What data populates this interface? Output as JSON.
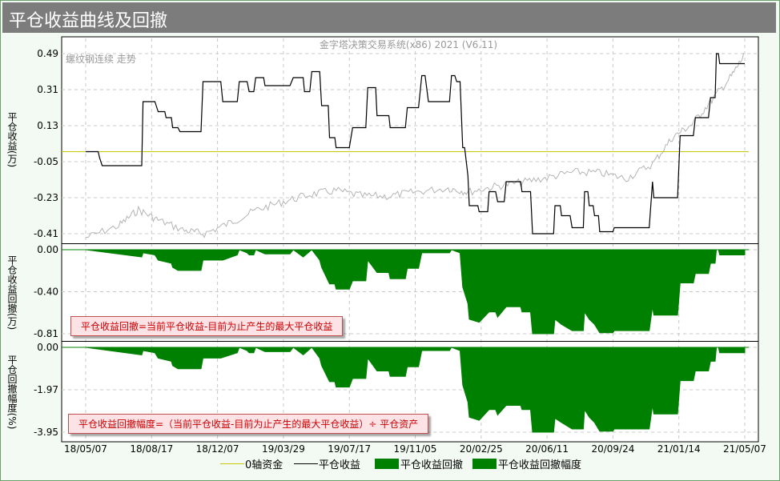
{
  "title": "平仓收益曲线及回撤",
  "watermark": "金字塔决策交易系统(x86) 2021 (V6.11)",
  "price_label": "螺纹钢连续 走势",
  "notes": {
    "drawdown": "平仓收益回撤=当前平仓收益-目前为止产生的最大平仓收益",
    "drawdown_pct": "平仓收益回撤幅度=（当前平仓收益-目前为止产生的最大平仓收益）÷ 平仓资产"
  },
  "colors": {
    "zero_line": "#c8c800",
    "equity": "#000000",
    "drawdown": "#008000",
    "price": "#b4b4b4",
    "grid": "#c8c8c8"
  },
  "legend": [
    {
      "label": "0轴资金",
      "kind": "line",
      "color": "#c8c800"
    },
    {
      "label": "平仓收益",
      "kind": "line",
      "color": "#000000"
    },
    {
      "label": "平仓收益回撤",
      "kind": "box",
      "color": "#008000"
    },
    {
      "label": "平仓收益回撤幅度",
      "kind": "box",
      "color": "#008000"
    }
  ],
  "chart_data": [
    {
      "type": "line",
      "ylabel": "平仓收益(万)",
      "yticks": [
        "0.49",
        "0.31",
        "0.13",
        "-0.05",
        "-0.23",
        "-0.41"
      ],
      "ylim": [
        -0.41,
        0.49
      ],
      "x": [
        "18/05/07",
        "18/08/17",
        "18/12/07",
        "19/03/29",
        "19/07/17",
        "19/11/05",
        "20/02/25",
        "20/06/11",
        "20/09/24",
        "21/01/14",
        "21/05/07"
      ],
      "zero_line": 0.0,
      "series": [
        {
          "name": "平仓收益",
          "points": [
            [
              0,
              0
            ],
            [
              0.19,
              0
            ],
            [
              0.21,
              -0.03
            ],
            [
              0.25,
              -0.07
            ],
            [
              0.85,
              -0.07
            ],
            [
              0.87,
              0.25
            ],
            [
              1.05,
              0.25
            ],
            [
              1.1,
              0.2
            ],
            [
              1.2,
              0.2
            ],
            [
              1.22,
              0.17
            ],
            [
              1.3,
              0.17
            ],
            [
              1.32,
              0.12
            ],
            [
              1.4,
              0.12
            ],
            [
              1.43,
              0.1
            ],
            [
              1.75,
              0.1
            ],
            [
              1.78,
              0.35
            ],
            [
              2.05,
              0.35
            ],
            [
              2.08,
              0.25
            ],
            [
              2.3,
              0.25
            ],
            [
              2.33,
              0.35
            ],
            [
              2.45,
              0.35
            ],
            [
              2.48,
              0.3
            ],
            [
              2.55,
              0.3
            ],
            [
              2.58,
              0.37
            ],
            [
              2.7,
              0.37
            ],
            [
              2.72,
              0.33
            ],
            [
              3.1,
              0.33
            ],
            [
              3.15,
              0.37
            ],
            [
              3.3,
              0.37
            ],
            [
              3.32,
              0.3
            ],
            [
              3.4,
              0.3
            ],
            [
              3.43,
              0.4
            ],
            [
              3.55,
              0.4
            ],
            [
              3.58,
              0.23
            ],
            [
              3.68,
              0.23
            ],
            [
              3.7,
              0.07
            ],
            [
              3.78,
              0.07
            ],
            [
              3.8,
              0.02
            ],
            [
              4.0,
              0.02
            ],
            [
              4.05,
              0.12
            ],
            [
              4.25,
              0.12
            ],
            [
              4.28,
              0.32
            ],
            [
              4.4,
              0.32
            ],
            [
              4.42,
              0.18
            ],
            [
              4.6,
              0.18
            ],
            [
              4.62,
              0.12
            ],
            [
              4.85,
              0.12
            ],
            [
              4.88,
              0.22
            ],
            [
              5.05,
              0.22
            ],
            [
              5.1,
              0.38
            ],
            [
              5.15,
              0.38
            ],
            [
              5.2,
              0.25
            ],
            [
              5.52,
              0.25
            ],
            [
              5.55,
              0.38
            ],
            [
              5.6,
              0.38
            ],
            [
              5.63,
              0.35
            ],
            [
              5.68,
              0.35
            ],
            [
              5.72,
              0.02
            ],
            [
              5.75,
              0.02
            ],
            [
              5.8,
              -0.12
            ],
            [
              5.82,
              -0.27
            ],
            [
              5.95,
              -0.27
            ],
            [
              5.97,
              -0.3
            ],
            [
              6.1,
              -0.3
            ],
            [
              6.12,
              -0.2
            ],
            [
              6.22,
              -0.2
            ],
            [
              6.25,
              -0.25
            ],
            [
              6.35,
              -0.25
            ],
            [
              6.38,
              -0.15
            ],
            [
              6.6,
              -0.15
            ],
            [
              6.62,
              -0.2
            ],
            [
              6.75,
              -0.2
            ],
            [
              6.78,
              -0.41
            ],
            [
              7.1,
              -0.41
            ],
            [
              7.12,
              -0.27
            ],
            [
              7.2,
              -0.27
            ],
            [
              7.22,
              -0.32
            ],
            [
              7.35,
              -0.32
            ],
            [
              7.38,
              -0.38
            ],
            [
              7.55,
              -0.38
            ],
            [
              7.57,
              -0.2
            ],
            [
              7.62,
              -0.2
            ],
            [
              7.64,
              -0.27
            ],
            [
              7.7,
              -0.27
            ],
            [
              7.72,
              -0.32
            ],
            [
              7.78,
              -0.32
            ],
            [
              7.8,
              -0.4
            ],
            [
              8.0,
              -0.4
            ],
            [
              8.02,
              -0.38
            ],
            [
              8.55,
              -0.38
            ],
            [
              8.6,
              -0.15
            ],
            [
              8.62,
              -0.23
            ],
            [
              8.98,
              -0.23
            ],
            [
              9.02,
              0.08
            ],
            [
              9.22,
              0.08
            ],
            [
              9.25,
              0.17
            ],
            [
              9.45,
              0.17
            ],
            [
              9.48,
              0.27
            ],
            [
              9.55,
              0.27
            ],
            [
              9.57,
              0.49
            ],
            [
              9.6,
              0.49
            ],
            [
              9.62,
              0.44
            ],
            [
              10.0,
              0.44
            ]
          ]
        }
      ]
    },
    {
      "type": "area",
      "ylabel": "平仓收益回撤(万)",
      "yticks": [
        "0.00",
        "-0.40",
        "-0.81"
      ],
      "ylim": [
        -0.81,
        0.0
      ],
      "series": [
        {
          "name": "平仓收益回撤",
          "points": [
            [
              0,
              0
            ],
            [
              0.85,
              -0.07
            ],
            [
              0.87,
              -0.03
            ],
            [
              1.05,
              -0.05
            ],
            [
              1.1,
              -0.1
            ],
            [
              1.3,
              -0.13
            ],
            [
              1.32,
              -0.17
            ],
            [
              1.4,
              -0.2
            ],
            [
              1.43,
              -0.2
            ],
            [
              1.75,
              -0.2
            ],
            [
              1.78,
              -0.1
            ],
            [
              2.05,
              -0.1
            ],
            [
              2.08,
              -0.1
            ],
            [
              2.3,
              -0.05
            ],
            [
              2.33,
              0
            ],
            [
              2.45,
              -0.03
            ],
            [
              2.48,
              -0.05
            ],
            [
              2.55,
              -0.05
            ],
            [
              2.58,
              0
            ],
            [
              2.72,
              -0.04
            ],
            [
              3.1,
              -0.04
            ],
            [
              3.15,
              0
            ],
            [
              3.3,
              -0.07
            ],
            [
              3.43,
              0
            ],
            [
              3.55,
              -0.1
            ],
            [
              3.58,
              -0.17
            ],
            [
              3.7,
              -0.33
            ],
            [
              3.78,
              -0.33
            ],
            [
              3.8,
              -0.38
            ],
            [
              4.0,
              -0.38
            ],
            [
              4.05,
              -0.3
            ],
            [
              4.25,
              -0.3
            ],
            [
              4.28,
              -0.1
            ],
            [
              4.42,
              -0.22
            ],
            [
              4.6,
              -0.22
            ],
            [
              4.62,
              -0.28
            ],
            [
              4.85,
              -0.28
            ],
            [
              4.88,
              -0.18
            ],
            [
              5.05,
              -0.18
            ],
            [
              5.1,
              -0.03
            ],
            [
              5.2,
              -0.03
            ],
            [
              5.52,
              -0.03
            ],
            [
              5.55,
              0
            ],
            [
              5.68,
              -0.03
            ],
            [
              5.72,
              -0.36
            ],
            [
              5.8,
              -0.52
            ],
            [
              5.82,
              -0.67
            ],
            [
              5.97,
              -0.7
            ],
            [
              6.12,
              -0.6
            ],
            [
              6.22,
              -0.6
            ],
            [
              6.25,
              -0.65
            ],
            [
              6.38,
              -0.55
            ],
            [
              6.6,
              -0.55
            ],
            [
              6.62,
              -0.6
            ],
            [
              6.75,
              -0.6
            ],
            [
              6.78,
              -0.81
            ],
            [
              7.1,
              -0.81
            ],
            [
              7.12,
              -0.67
            ],
            [
              7.22,
              -0.72
            ],
            [
              7.38,
              -0.78
            ],
            [
              7.55,
              -0.78
            ],
            [
              7.57,
              -0.6
            ],
            [
              7.64,
              -0.67
            ],
            [
              7.72,
              -0.72
            ],
            [
              7.8,
              -0.8
            ],
            [
              8.0,
              -0.8
            ],
            [
              8.02,
              -0.78
            ],
            [
              8.55,
              -0.78
            ],
            [
              8.6,
              -0.55
            ],
            [
              8.62,
              -0.63
            ],
            [
              8.98,
              -0.63
            ],
            [
              9.02,
              -0.32
            ],
            [
              9.22,
              -0.32
            ],
            [
              9.25,
              -0.23
            ],
            [
              9.45,
              -0.23
            ],
            [
              9.48,
              -0.13
            ],
            [
              9.55,
              -0.13
            ],
            [
              9.57,
              0
            ],
            [
              9.6,
              0
            ],
            [
              9.62,
              -0.05
            ],
            [
              10.0,
              -0.05
            ]
          ]
        }
      ]
    },
    {
      "type": "area",
      "ylabel": "平仓回撤幅度(%)",
      "yticks": [
        "0.00",
        "-1.97",
        "-3.95"
      ],
      "ylim": [
        -3.95,
        0.0
      ],
      "series": [
        {
          "name": "平仓收益回撤幅度",
          "points": [
            [
              0,
              0
            ],
            [
              0.85,
              -0.35
            ],
            [
              0.87,
              -0.15
            ],
            [
              1.05,
              -0.25
            ],
            [
              1.1,
              -0.5
            ],
            [
              1.3,
              -0.65
            ],
            [
              1.32,
              -0.85
            ],
            [
              1.4,
              -1.0
            ],
            [
              1.75,
              -1.0
            ],
            [
              1.78,
              -0.5
            ],
            [
              2.05,
              -0.5
            ],
            [
              2.3,
              -0.25
            ],
            [
              2.33,
              0
            ],
            [
              2.45,
              -0.15
            ],
            [
              2.48,
              -0.25
            ],
            [
              2.55,
              -0.25
            ],
            [
              2.58,
              0
            ],
            [
              2.72,
              -0.2
            ],
            [
              3.1,
              -0.2
            ],
            [
              3.15,
              0
            ],
            [
              3.3,
              -0.35
            ],
            [
              3.43,
              0
            ],
            [
              3.55,
              -0.5
            ],
            [
              3.58,
              -0.85
            ],
            [
              3.7,
              -1.6
            ],
            [
              3.78,
              -1.6
            ],
            [
              3.8,
              -1.85
            ],
            [
              4.0,
              -1.85
            ],
            [
              4.05,
              -1.45
            ],
            [
              4.25,
              -1.45
            ],
            [
              4.28,
              -0.5
            ],
            [
              4.42,
              -1.1
            ],
            [
              4.6,
              -1.1
            ],
            [
              4.62,
              -1.35
            ],
            [
              4.85,
              -1.35
            ],
            [
              4.88,
              -0.9
            ],
            [
              5.05,
              -0.9
            ],
            [
              5.1,
              -0.15
            ],
            [
              5.52,
              -0.15
            ],
            [
              5.55,
              0
            ],
            [
              5.68,
              -0.15
            ],
            [
              5.72,
              -1.75
            ],
            [
              5.8,
              -2.55
            ],
            [
              5.82,
              -3.25
            ],
            [
              5.97,
              -3.4
            ],
            [
              6.12,
              -2.9
            ],
            [
              6.22,
              -2.9
            ],
            [
              6.25,
              -3.15
            ],
            [
              6.38,
              -2.7
            ],
            [
              6.6,
              -2.7
            ],
            [
              6.62,
              -2.9
            ],
            [
              6.75,
              -2.9
            ],
            [
              6.78,
              -3.95
            ],
            [
              7.1,
              -3.95
            ],
            [
              7.12,
              -3.3
            ],
            [
              7.22,
              -3.5
            ],
            [
              7.38,
              -3.8
            ],
            [
              7.55,
              -3.8
            ],
            [
              7.57,
              -2.9
            ],
            [
              7.64,
              -3.25
            ],
            [
              7.72,
              -3.5
            ],
            [
              7.8,
              -3.9
            ],
            [
              8.0,
              -3.9
            ],
            [
              8.02,
              -3.8
            ],
            [
              8.55,
              -3.8
            ],
            [
              8.6,
              -2.7
            ],
            [
              8.62,
              -3.1
            ],
            [
              8.98,
              -3.1
            ],
            [
              9.02,
              -1.55
            ],
            [
              9.22,
              -1.55
            ],
            [
              9.25,
              -1.1
            ],
            [
              9.45,
              -1.1
            ],
            [
              9.48,
              -0.65
            ],
            [
              9.55,
              -0.65
            ],
            [
              9.57,
              0
            ],
            [
              9.6,
              0
            ],
            [
              9.62,
              -0.25
            ],
            [
              10.0,
              -0.25
            ]
          ]
        }
      ]
    }
  ]
}
